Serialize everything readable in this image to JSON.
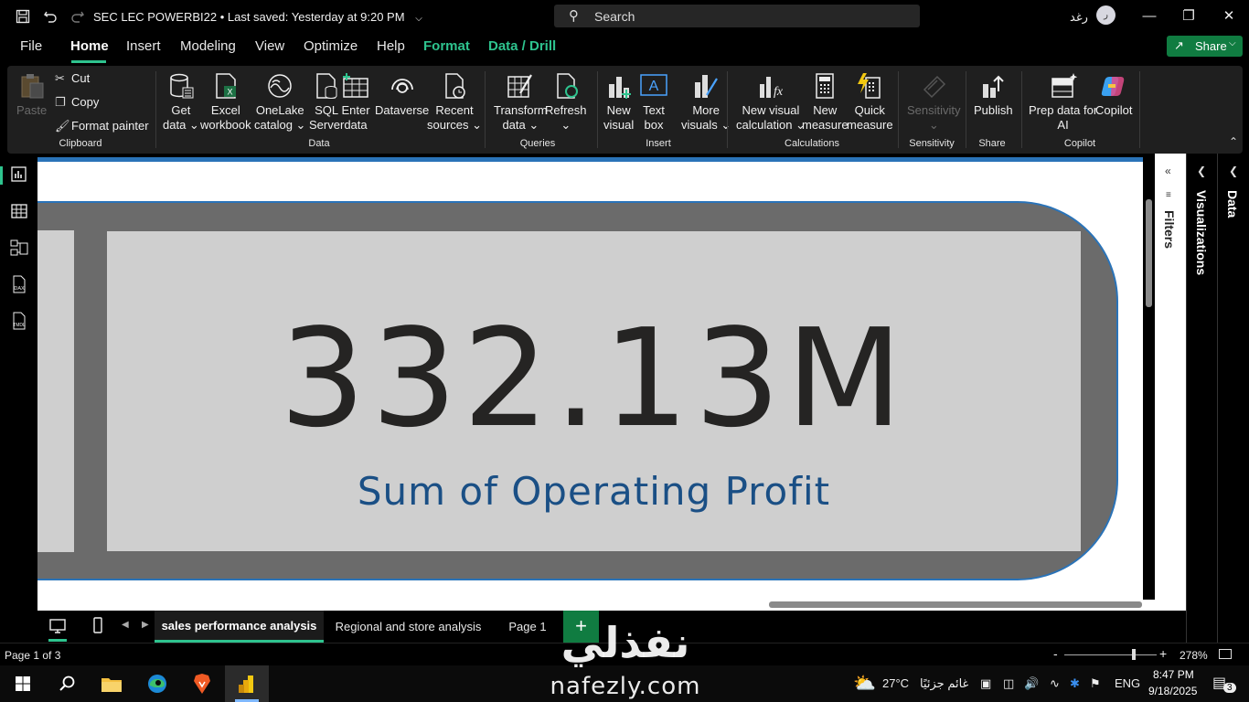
{
  "titlebar": {
    "doc_title": "SEC LEC POWERBI22  •  Last saved: Yesterday at 9:20 PM",
    "search_placeholder": "Search",
    "user_name": "رغد",
    "avatar_initials": "ر"
  },
  "menu": {
    "tabs": [
      "File",
      "Home",
      "Insert",
      "Modeling",
      "View",
      "Optimize",
      "Help",
      "Format",
      "Data / Drill"
    ],
    "active_tab": "Home",
    "share_label": "Share"
  },
  "ribbon": {
    "clipboard": {
      "paste": "Paste",
      "cut": "Cut",
      "copy": "Copy",
      "format_painter": "Format painter",
      "group": "Clipboard"
    },
    "data": {
      "get_data": [
        "Get",
        "data"
      ],
      "excel": [
        "Excel",
        "workbook"
      ],
      "onelake": [
        "OneLake",
        "catalog"
      ],
      "sql": [
        "SQL",
        "Server"
      ],
      "enter": [
        "Enter",
        "data"
      ],
      "dataverse": [
        "Dataverse",
        ""
      ],
      "recent": [
        "Recent",
        "sources"
      ],
      "group": "Data"
    },
    "queries": {
      "transform": [
        "Transform",
        "data"
      ],
      "refresh": [
        "Refresh",
        ""
      ],
      "group": "Queries"
    },
    "insert": {
      "new_visual": [
        "New",
        "visual"
      ],
      "text_box": [
        "Text",
        "box"
      ],
      "more_visuals": [
        "More",
        "visuals"
      ],
      "group": "Insert"
    },
    "calculations": {
      "new_visual_calc": [
        "New visual",
        "calculation"
      ],
      "new_measure": [
        "New",
        "measure"
      ],
      "quick_measure": [
        "Quick",
        "measure"
      ],
      "group": "Calculations"
    },
    "sensitivity": {
      "sensitivity": [
        "Sensitivity",
        ""
      ],
      "group": "Sensitivity"
    },
    "share": {
      "publish": [
        "Publish",
        ""
      ],
      "group": "Share"
    },
    "copilot": {
      "prep": [
        "Prep data for",
        "AI"
      ],
      "copilot": [
        "Copilot",
        ""
      ],
      "group": "Copilot"
    }
  },
  "card": {
    "value": "332.13M",
    "label": "Sum of Operating Profit"
  },
  "panes": {
    "filters": "Filters",
    "visualizations": "Visualizations",
    "data": "Data"
  },
  "page_tabs": {
    "pages": [
      "sales performance analysis",
      "Regional and store analysis",
      "Page 1"
    ],
    "active": "sales performance analysis"
  },
  "status": {
    "page_indicator": "Page 1 of 3",
    "zoom": "278%",
    "zoom_fraction": 0.75
  },
  "taskbar": {
    "temperature": "27°C",
    "weather_text": "غائم جزئيًا",
    "language": "ENG",
    "time": "8:47 PM",
    "date": "9/18/2025",
    "notifications": "3"
  },
  "watermark": {
    "arabic": "نفذلي",
    "latin": "nafezly.com"
  },
  "colors": {
    "accent_green": "#2ec38e",
    "share_green": "#107c41",
    "card_border_blue": "#2a73b8",
    "label_blue": "#1a4f85",
    "card_outer": "#6b6b6b",
    "card_inner": "#cfcfcf"
  }
}
